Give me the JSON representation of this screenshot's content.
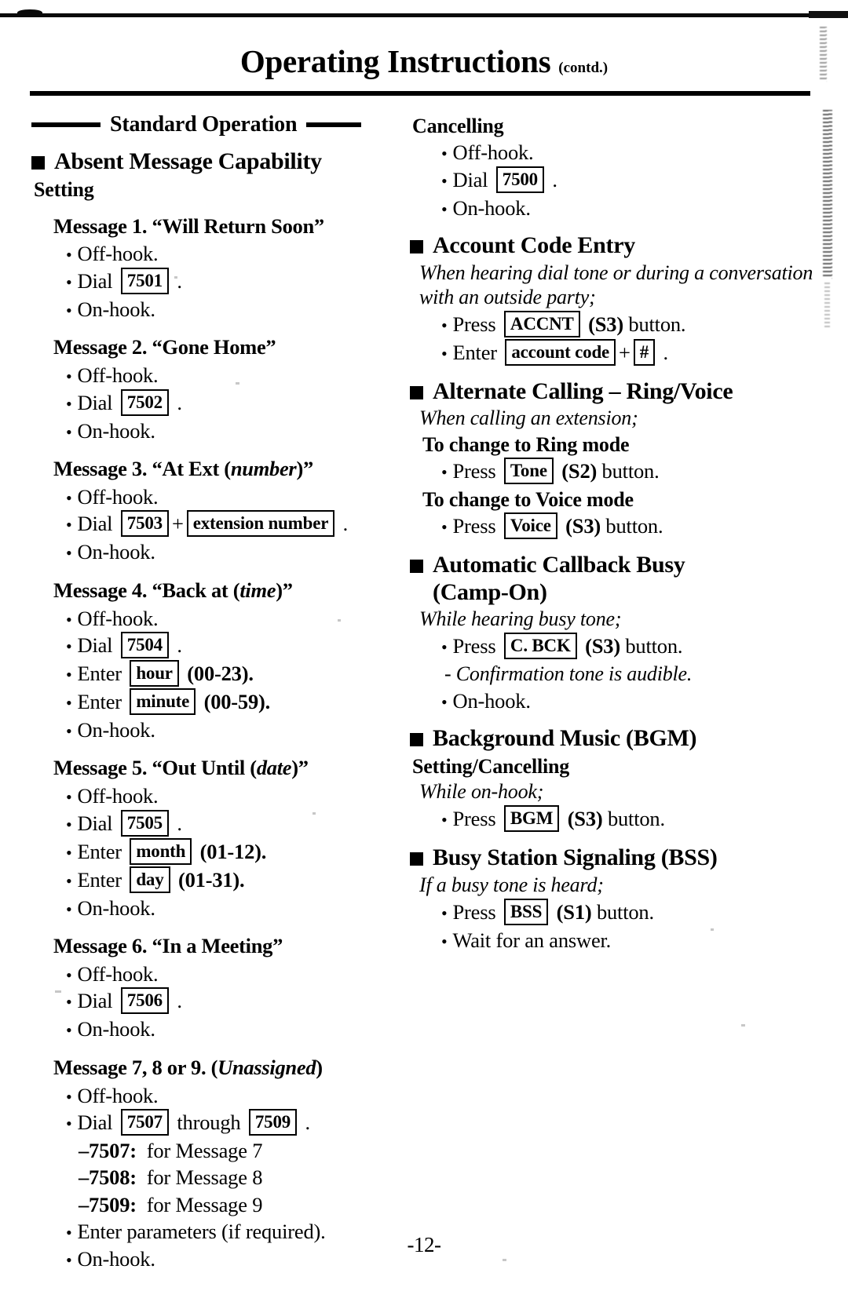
{
  "header": {
    "title": "Operating Instructions",
    "contd": "(contd.)"
  },
  "banner": {
    "label": "Standard Operation"
  },
  "footer": {
    "page_number": "-12-"
  },
  "left_column": {
    "section_title": "Absent Message Capability",
    "setting_label": "Setting",
    "messages": [
      {
        "title_prefix": "Message 1. “Will Return Soon”",
        "title_param": "",
        "title_suffix": "",
        "steps": [
          {
            "pre": "Off-hook.",
            "box": "",
            "post": ""
          },
          {
            "pre": "Dial ",
            "box": "7501",
            "post": "."
          },
          {
            "pre": "On-hook.",
            "box": "",
            "post": ""
          }
        ]
      },
      {
        "title_prefix": "Message 2. “Gone Home”",
        "title_param": "",
        "title_suffix": "",
        "steps": [
          {
            "pre": "Off-hook.",
            "box": "",
            "post": ""
          },
          {
            "pre": "Dial ",
            "box": "7502",
            "post": "."
          },
          {
            "pre": "On-hook.",
            "box": "",
            "post": ""
          }
        ]
      },
      {
        "title_prefix": "Message 3. “At Ext (",
        "title_param": "number",
        "title_suffix": ")”",
        "steps": [
          {
            "pre": "Off-hook.",
            "box": "",
            "post": ""
          },
          {
            "pre": "Dial ",
            "box": "7503",
            "plus": "+",
            "box2": "extension number",
            "post": "."
          },
          {
            "pre": "On-hook.",
            "box": "",
            "post": ""
          }
        ]
      },
      {
        "title_prefix": "Message 4. “Back at (",
        "title_param": "time",
        "title_suffix": ")”",
        "steps": [
          {
            "pre": "Off-hook.",
            "box": "",
            "post": ""
          },
          {
            "pre": "Dial ",
            "box": "7504",
            "post": "."
          },
          {
            "pre": "Enter ",
            "box": "hour",
            "post": "(00-23).",
            "post_bold": true
          },
          {
            "pre": "Enter ",
            "box": "minute",
            "post": "(00-59).",
            "post_bold": true
          },
          {
            "pre": "On-hook.",
            "box": "",
            "post": ""
          }
        ]
      },
      {
        "title_prefix": "Message 5. “Out Until (",
        "title_param": "date",
        "title_suffix": ")”",
        "steps": [
          {
            "pre": "Off-hook.",
            "box": "",
            "post": ""
          },
          {
            "pre": "Dial ",
            "box": "7505",
            "post": "."
          },
          {
            "pre": "Enter ",
            "box": "month",
            "post": "(01-12).",
            "post_bold": true
          },
          {
            "pre": "Enter ",
            "box": "day",
            "post": "(01-31).",
            "post_bold": true
          },
          {
            "pre": "On-hook.",
            "box": "",
            "post": ""
          }
        ]
      },
      {
        "title_prefix": "Message 6. “In a Meeting”",
        "title_param": "",
        "title_suffix": "",
        "steps": [
          {
            "pre": "Off-hook.",
            "box": "",
            "post": ""
          },
          {
            "pre": "Dial ",
            "box": "7506",
            "post": "."
          },
          {
            "pre": "On-hook.",
            "box": "",
            "post": ""
          }
        ]
      },
      {
        "title_prefix": "Message 7, 8 or 9. (",
        "title_param": "Unassigned",
        "title_suffix": ")",
        "title_param_bold": true,
        "steps": [
          {
            "pre": "Off-hook.",
            "box": "",
            "post": ""
          },
          {
            "pre": "Dial ",
            "box": "7507",
            "mid": "through",
            "box2": "7509",
            "post": "."
          }
        ],
        "dash_lines": [
          {
            "code": "–7507:",
            "text": "for Message 7"
          },
          {
            "code": "–7508:",
            "text": "for Message 8"
          },
          {
            "code": "–7509:",
            "text": "for Message 9"
          }
        ],
        "tail_steps": [
          {
            "pre": "Enter parameters (if required).",
            "box": "",
            "post": ""
          },
          {
            "pre": "On-hook.",
            "box": "",
            "post": ""
          }
        ]
      }
    ]
  },
  "right_column": {
    "cancelling": {
      "heading": "Cancelling",
      "steps": [
        {
          "pre": "Off-hook.",
          "box": "",
          "post": ""
        },
        {
          "pre": "Dial ",
          "box": "7500",
          "post": "."
        },
        {
          "pre": "On-hook.",
          "box": "",
          "post": ""
        }
      ]
    },
    "sections": [
      {
        "title": "Account Code Entry",
        "context": "When hearing dial tone or during a conversation with an outside party;",
        "steps": [
          {
            "pre": "Press ",
            "box": "ACCNT",
            "post": "(S3) button.",
            "post_bold_head": "(S3)"
          },
          {
            "pre": "Enter ",
            "box": "account code",
            "plus": "+",
            "box2": "#",
            "post": "."
          }
        ]
      },
      {
        "title": "Alternate Calling – Ring/Voice",
        "context": "When calling an extension;",
        "subgroups": [
          {
            "subhead": "To change to Ring mode",
            "steps": [
              {
                "pre": "Press ",
                "box": "Tone",
                "post": "(S2) button."
              }
            ]
          },
          {
            "subhead": "To change to Voice mode",
            "steps": [
              {
                "pre": "Press ",
                "box": "Voice",
                "post": "(S3) button."
              }
            ]
          }
        ]
      },
      {
        "title": "Automatic Callback Busy",
        "title_line2": "(Camp-On)",
        "context": "While hearing busy tone;",
        "steps": [
          {
            "pre": "Press ",
            "box": "C. BCK",
            "post": "(S3) button."
          }
        ],
        "note": "- Confirmation tone is audible.",
        "tail_steps": [
          {
            "pre": "On-hook.",
            "box": "",
            "post": ""
          }
        ]
      },
      {
        "title": "Background Music (BGM)",
        "subhead": "Setting/Cancelling",
        "context": "While on-hook;",
        "steps": [
          {
            "pre": "Press ",
            "box": "BGM",
            "post": "(S3) button."
          }
        ]
      },
      {
        "title": "Busy Station Signaling (BSS)",
        "context": "If a busy tone is heard;",
        "steps": [
          {
            "pre": "Press ",
            "box": "BSS",
            "post": "(S1) button."
          },
          {
            "pre": "Wait for an answer.",
            "box": "",
            "post": ""
          }
        ]
      }
    ]
  }
}
